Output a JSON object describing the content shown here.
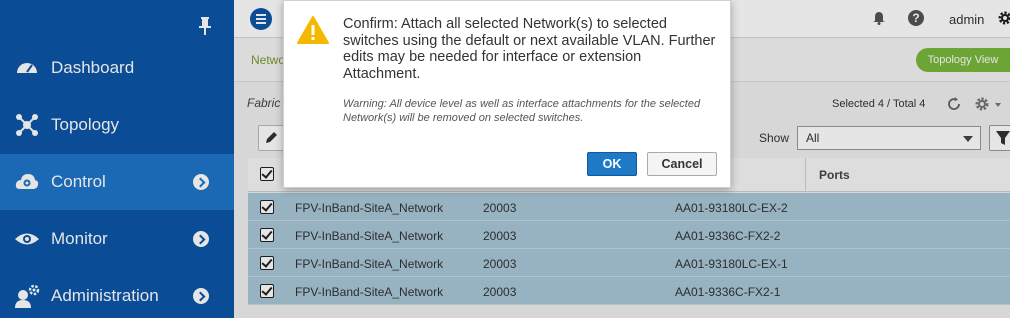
{
  "sidebar": {
    "items": [
      {
        "label": "Dashboard",
        "icon": "dashboard-icon"
      },
      {
        "label": "Topology",
        "icon": "topology-icon"
      },
      {
        "label": "Control",
        "icon": "control-cloud-icon",
        "active": true
      },
      {
        "label": "Monitor",
        "icon": "monitor-eye-icon"
      },
      {
        "label": "Administration",
        "icon": "administration-icon"
      }
    ]
  },
  "header": {
    "user": "admin",
    "help_glyph": "?"
  },
  "content": {
    "breadcrumb": "Netwo",
    "topology_view_label": "Topology View",
    "fabric_label": "Fabric",
    "selection_status": "Selected 4 / Total 4",
    "show_label": "Show",
    "show_value": "All",
    "table": {
      "columns": [
        "Ports"
      ],
      "rows": [
        {
          "network": "FPV-InBand-SiteA_Network",
          "id": "20003",
          "switch": "AA01-93180LC-EX-2"
        },
        {
          "network": "FPV-InBand-SiteA_Network",
          "id": "20003",
          "switch": "AA01-9336C-FX2-2"
        },
        {
          "network": "FPV-InBand-SiteA_Network",
          "id": "20003",
          "switch": "AA01-93180LC-EX-1"
        },
        {
          "network": "FPV-InBand-SiteA_Network",
          "id": "20003",
          "switch": "AA01-9336C-FX2-1"
        }
      ]
    }
  },
  "modal": {
    "message": "Confirm: Attach all selected Network(s) to selected switches using the default or next available VLAN. Further edits may be needed for interface or extension Attachment.",
    "warning": "Warning: All device level as well as interface attachments for the selected Network(s) will be removed on selected switches.",
    "ok_label": "OK",
    "cancel_label": "Cancel"
  },
  "colors": {
    "sidebar_bg": "#0d55a8",
    "sidebar_active": "#1f74c9",
    "row_selected": "#a9c8d8",
    "topology_button": "#79b83b",
    "ok_button": "#1e79c7",
    "warning_icon": "#f5b800"
  }
}
